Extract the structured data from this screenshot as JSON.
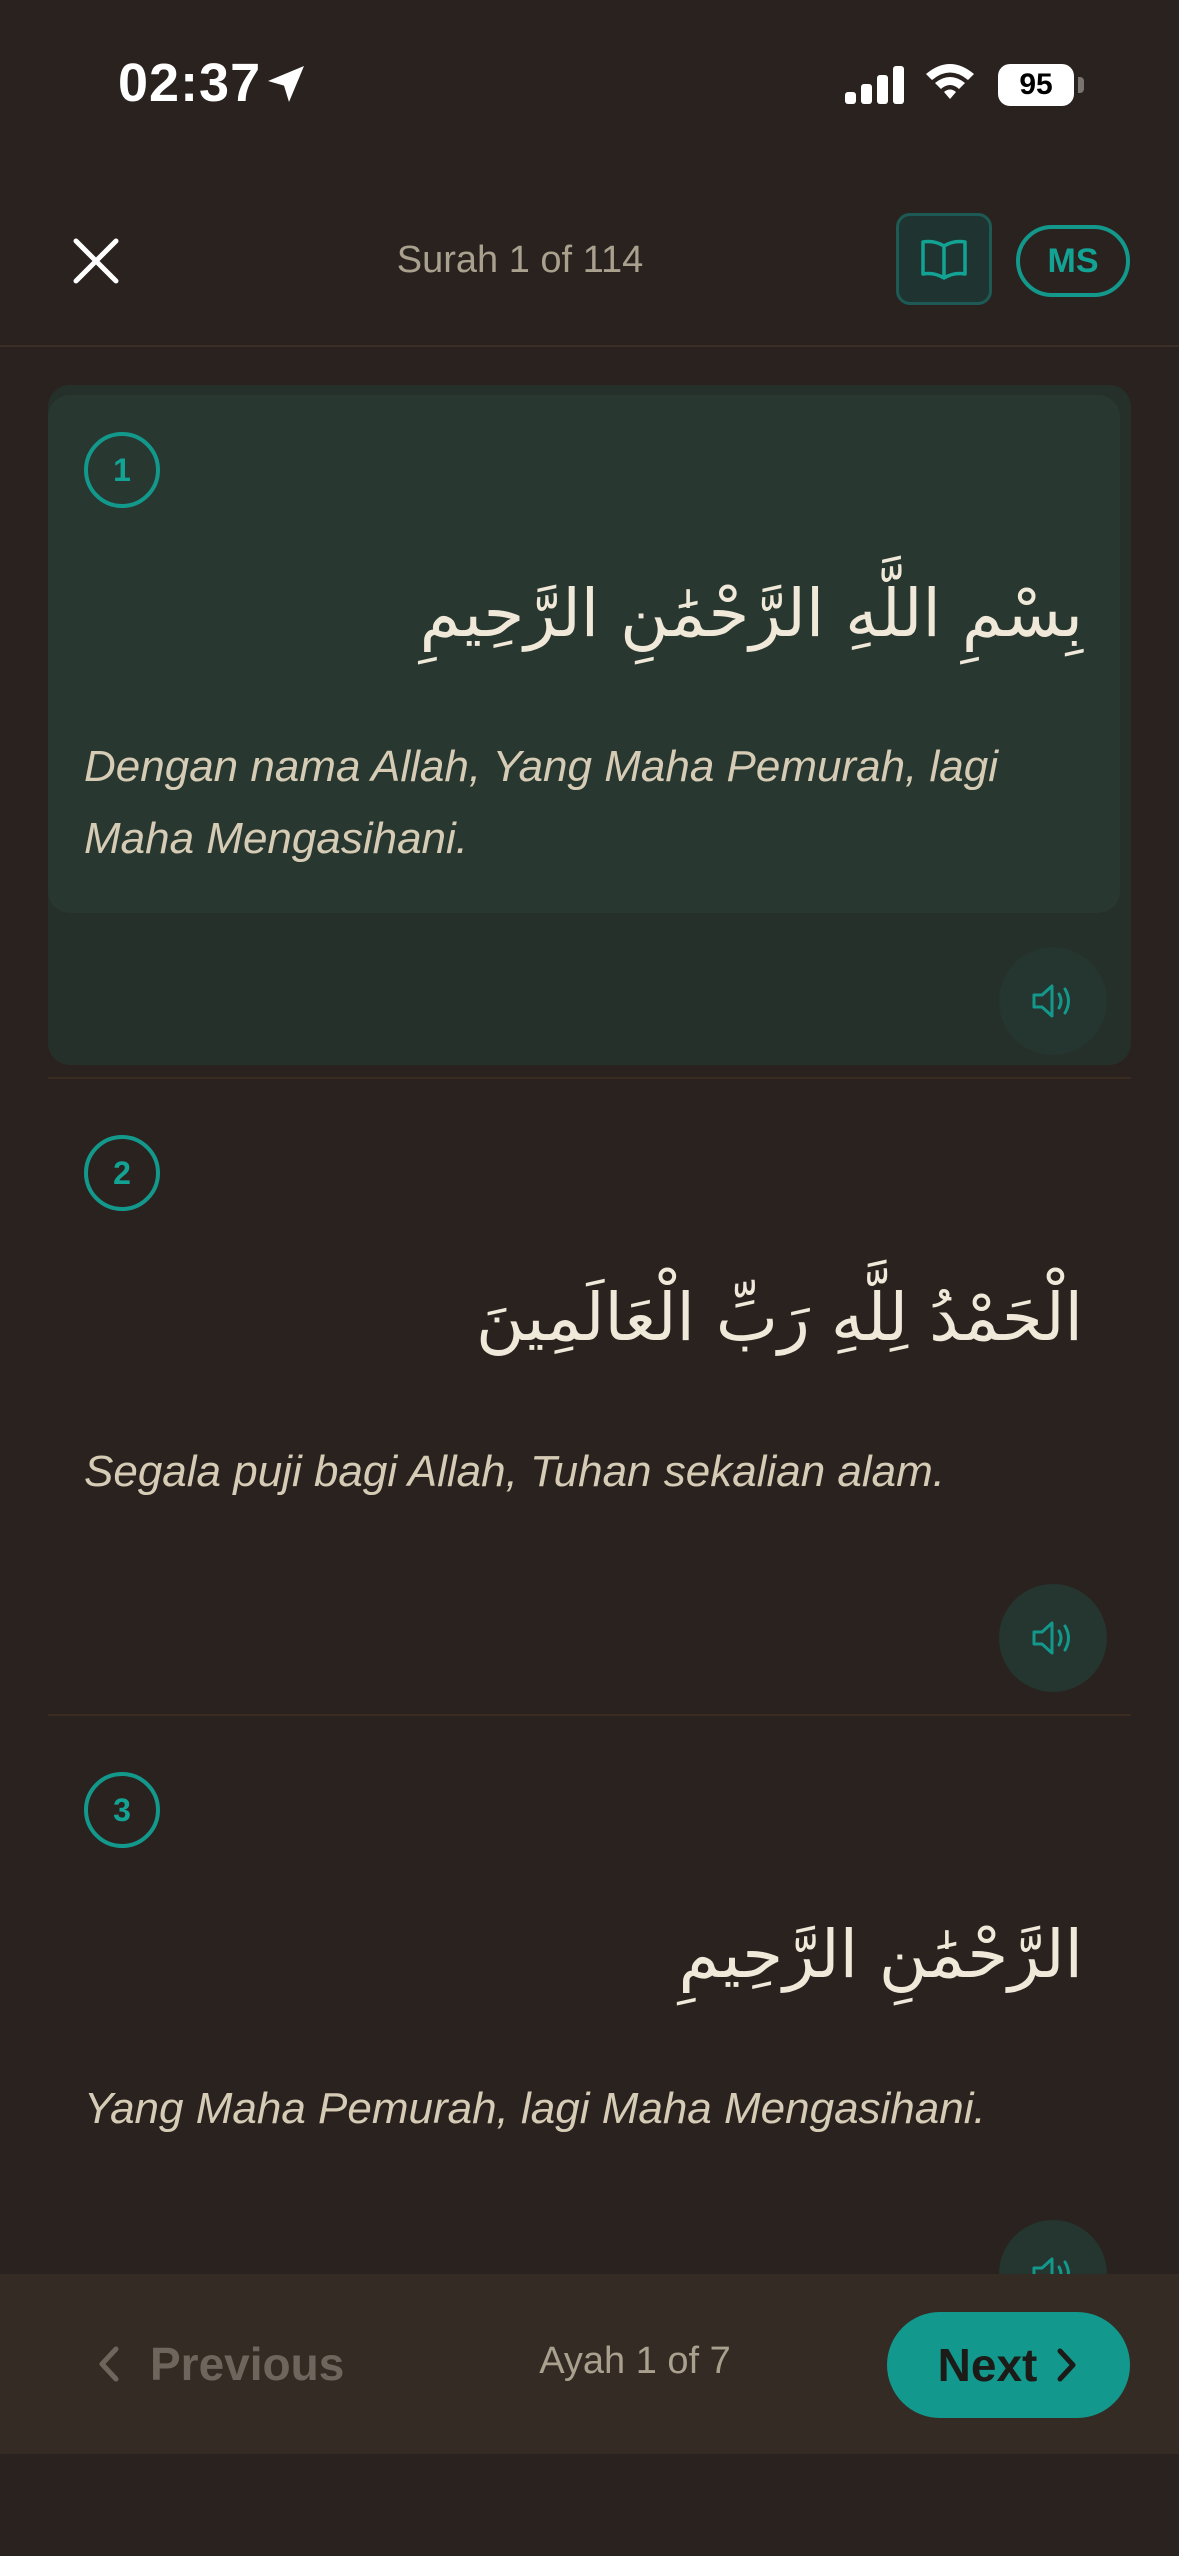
{
  "status": {
    "time": "02:37",
    "battery": "95"
  },
  "header": {
    "title": "Surah 1 of 114",
    "lang": "MS"
  },
  "ayahs": [
    {
      "num": "1",
      "arabic": "بِسْمِ اللَّهِ الرَّحْمَٰنِ الرَّحِيمِ",
      "translation": "Dengan nama Allah, Yang Maha Pemurah, lagi Maha Mengasihani."
    },
    {
      "num": "2",
      "arabic": "الْحَمْدُ لِلَّهِ رَبِّ الْعَالَمِينَ",
      "translation": "Segala puji bagi Allah, Tuhan sekalian alam."
    },
    {
      "num": "3",
      "arabic": "الرَّحْمَٰنِ الرَّحِيمِ",
      "translation": "Yang Maha Pemurah, lagi Maha Mengasihani."
    }
  ],
  "footer": {
    "previous": "Previous",
    "counter": "Ayah 1 of 7",
    "next": "Next"
  },
  "colors": {
    "accent": "#12988c",
    "background": "#2a221f",
    "active_card": "#28372f"
  }
}
